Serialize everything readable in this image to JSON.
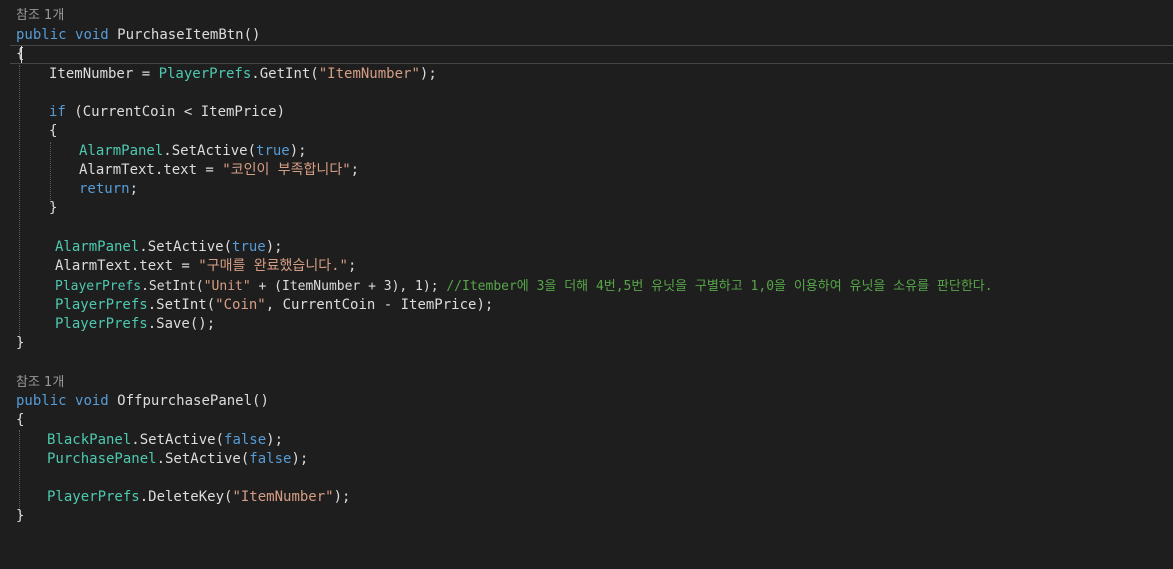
{
  "codelens": {
    "ref1": "참조 1개",
    "ref2": "참조 1개"
  },
  "colors": {
    "background": "#1e1e1e",
    "keyword": "#569cd6",
    "type": "#4ec9b0",
    "string": "#d69d85",
    "comment": "#57a64a",
    "text": "#dcdcdc"
  },
  "method1": {
    "kw_public": "public",
    "kw_void": "void",
    "name": "PurchaseItemBtn()",
    "open_brace": "{",
    "l1_a": "ItemNumber = ",
    "l1_type": "PlayerPrefs",
    "l1_b": ".GetInt(",
    "l1_str": "\"ItemNumber\"",
    "l1_c": ");",
    "if_kw": "if",
    "if_cond": " (CurrentCoin < ItemPrice)",
    "if_open": "{",
    "l2_type": "AlarmPanel",
    "l2_a": ".SetActive(",
    "l2_kw": "true",
    "l2_b": ");",
    "l3_a": "AlarmText.text = ",
    "l3_str": "\"코인이 부족합니다\"",
    "l3_b": ";",
    "l4_kw": "return",
    "l4_b": ";",
    "if_close": "}",
    "l5_type": "AlarmPanel",
    "l5_a": ".SetActive(",
    "l5_kw": "true",
    "l5_b": ");",
    "l6_a": "AlarmText.text = ",
    "l6_str": "\"구매를 완료했습니다.\"",
    "l6_b": ";",
    "l7_type": "PlayerPrefs",
    "l7_a": ".SetInt(",
    "l7_str": "\"Unit\"",
    "l7_b": " + (ItemNumber + 3), 1); ",
    "l7_cmt": "//Itember에 3을 더해 4번,5번 유닛을 구별하고 1,0을 이용하여 유닛을 소유를 판단한다.",
    "l8_type": "PlayerPrefs",
    "l8_a": ".SetInt(",
    "l8_str": "\"Coin\"",
    "l8_b": ", CurrentCoin - ItemPrice);",
    "l9_type": "PlayerPrefs",
    "l9_a": ".Save();",
    "close_brace": "}"
  },
  "method2": {
    "kw_public": "public",
    "kw_void": "void",
    "name": "OffpurchasePanel()",
    "open_brace": "{",
    "l1_type": "BlackPanel",
    "l1_a": ".SetActive(",
    "l1_kw": "false",
    "l1_b": ");",
    "l2_type": "PurchasePanel",
    "l2_a": ".SetActive(",
    "l2_kw": "false",
    "l2_b": ");",
    "l3_type": "PlayerPrefs",
    "l3_a": ".DeleteKey(",
    "l3_str": "\"ItemNumber\"",
    "l3_b": ");",
    "close_brace": "}"
  }
}
